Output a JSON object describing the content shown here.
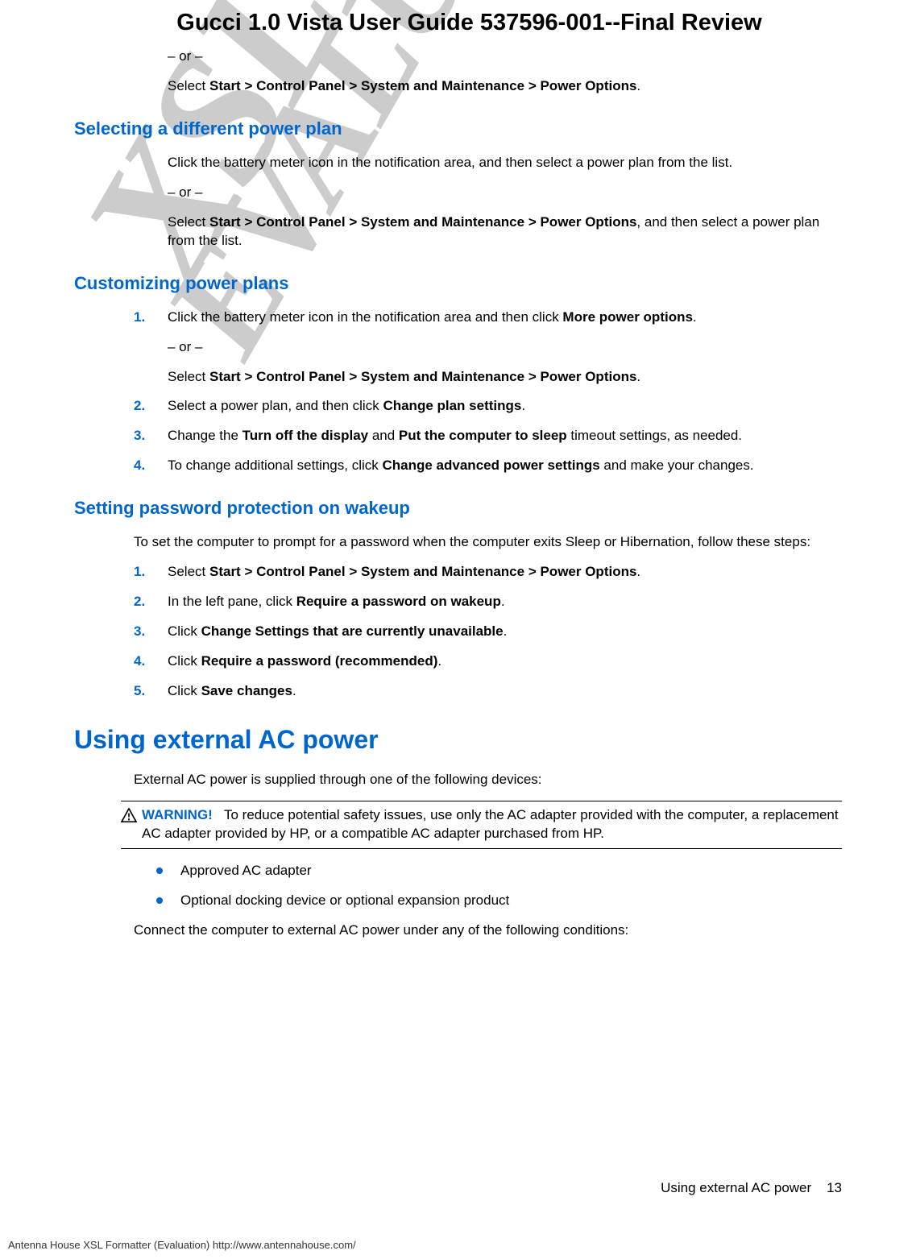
{
  "watermarks": {
    "line1": "XSLFormatter",
    "line2": "EVALUATION"
  },
  "doc_title": "Gucci 1.0 Vista User Guide 537596-001--Final Review",
  "intro": {
    "or1": "– or –",
    "p1a": "Select ",
    "p1b": "Start > Control Panel > System and Maintenance > Power Options",
    "p1c": "."
  },
  "sec1": {
    "heading": "Selecting a different power plan",
    "p1": "Click the battery meter icon in the notification area, and then select a power plan from the list.",
    "or": "– or –",
    "p2a": "Select ",
    "p2b": "Start > Control Panel > System and Maintenance > Power Options",
    "p2c": ", and then select a power plan from the list."
  },
  "sec2": {
    "heading": "Customizing power plans",
    "s1a": "Click the battery meter icon in the notification area and then click ",
    "s1b": "More power options",
    "s1c": ".",
    "s1_or": "– or –",
    "s1d": "Select ",
    "s1e": "Start > Control Panel > System and Maintenance > Power Options",
    "s1f": ".",
    "s2a": "Select a power plan, and then click ",
    "s2b": "Change plan settings",
    "s2c": ".",
    "s3a": "Change the ",
    "s3b": "Turn off the display",
    "s3c": " and ",
    "s3d": "Put the computer to sleep",
    "s3e": " timeout settings, as needed.",
    "s4a": "To change additional settings, click ",
    "s4b": "Change advanced power settings",
    "s4c": " and make your changes."
  },
  "sec3": {
    "heading": "Setting password protection on wakeup",
    "intro": "To set the computer to prompt for a password when the computer exits Sleep or Hibernation, follow these steps:",
    "s1a": "Select ",
    "s1b": "Start > Control Panel > System and Maintenance > Power Options",
    "s1c": ".",
    "s2a": "In the left pane, click ",
    "s2b": "Require a password on wakeup",
    "s2c": ".",
    "s3a": "Click ",
    "s3b": "Change Settings that are currently unavailable",
    "s3c": ".",
    "s4a": "Click ",
    "s4b": "Require a password (recommended)",
    "s4c": ".",
    "s5a": "Click ",
    "s5b": "Save changes",
    "s5c": "."
  },
  "sec4": {
    "heading": "Using external AC power",
    "p1": "External AC power is supplied through one of the following devices:",
    "warn_label": "WARNING!",
    "warn_text": "To reduce potential safety issues, use only the AC adapter provided with the computer, a replacement AC adapter provided by HP, or a compatible AC adapter purchased from HP.",
    "b1": "Approved AC adapter",
    "b2": "Optional docking device or optional expansion product",
    "p2": "Connect the computer to external AC power under any of the following conditions:"
  },
  "footer": {
    "section": "Using external AC power",
    "page": "13",
    "bottom": "Antenna House XSL Formatter (Evaluation)  http://www.antennahouse.com/"
  },
  "nums": {
    "n1": "1.",
    "n2": "2.",
    "n3": "3.",
    "n4": "4.",
    "n5": "5."
  }
}
